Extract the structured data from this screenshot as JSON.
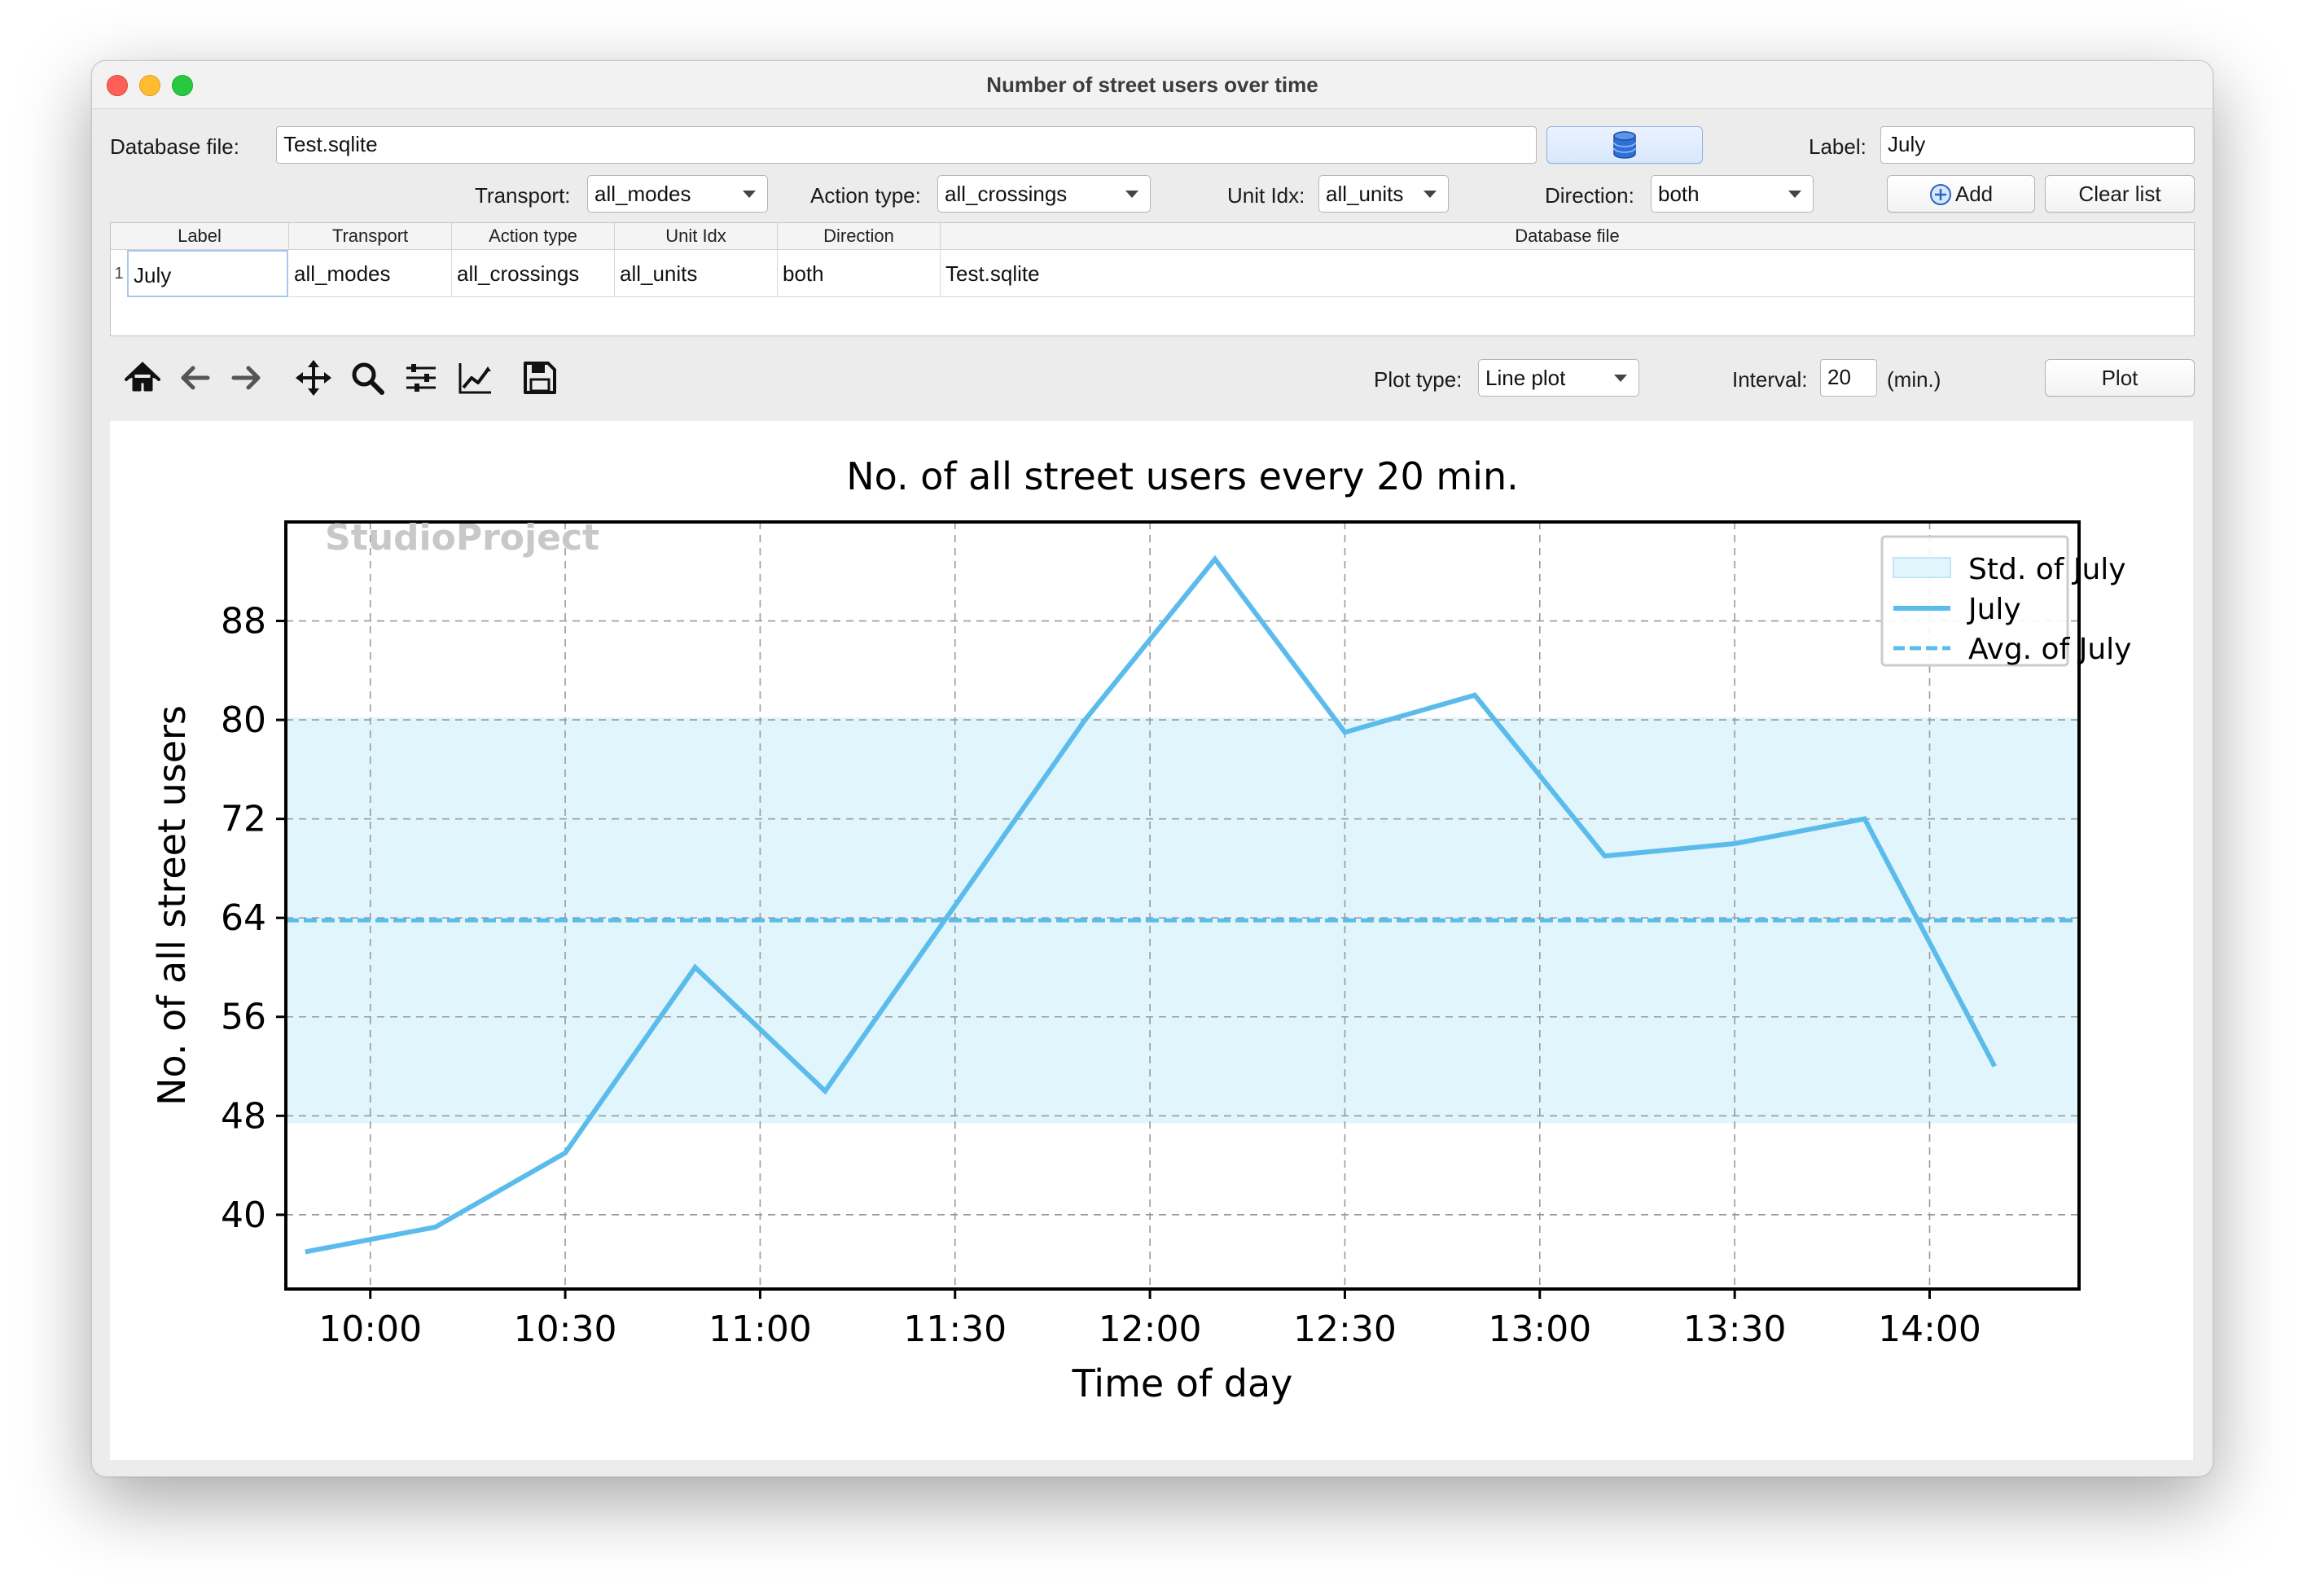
{
  "window": {
    "title": "Number of street users over time"
  },
  "controls": {
    "database_label": "Database file:",
    "database_value": "Test.sqlite",
    "db_button_icon": "database-icon",
    "label_label": "Label:",
    "label_value": "July",
    "transport_label": "Transport:",
    "transport_value": "all_modes",
    "action_label": "Action type:",
    "action_value": "all_crossings",
    "unit_label": "Unit Idx:",
    "unit_value": "all_units",
    "direction_label": "Direction:",
    "direction_value": "both",
    "add_label": "Add",
    "clear_label": "Clear list"
  },
  "table": {
    "headers": [
      "Label",
      "Transport",
      "Action type",
      "Unit Idx",
      "Direction",
      "Database file"
    ],
    "rows": [
      {
        "num": "1",
        "cells": [
          "July",
          "all_modes",
          "all_crossings",
          "all_units",
          "both",
          "Test.sqlite"
        ]
      }
    ]
  },
  "toolbar": {
    "icons": [
      "home-icon",
      "back-arrow-icon",
      "forward-arrow-icon",
      "pan-icon",
      "zoom-icon",
      "configure-subplots-icon",
      "edit-axes-icon",
      "save-icon"
    ],
    "plot_type_label": "Plot type:",
    "plot_type_value": "Line plot",
    "interval_label": "Interval:",
    "interval_value": "20",
    "interval_unit": "(min.)",
    "plot_button": "Plot"
  },
  "colors": {
    "line": "#5bbcec",
    "std_band": "#e1f5fc",
    "grid": "#9a9a9a"
  },
  "chart_data": {
    "type": "line",
    "title": "No. of all street users every 20 min.",
    "xlabel": "Time of day",
    "ylabel": "No. of all street users",
    "watermark": "StudioProject",
    "x_ticks": [
      "10:00",
      "10:30",
      "11:00",
      "11:30",
      "12:00",
      "12:30",
      "13:00",
      "13:30",
      "14:00"
    ],
    "y_ticks": [
      40,
      48,
      56,
      64,
      72,
      80,
      88
    ],
    "xlim": [
      "09:47",
      "14:23"
    ],
    "ylim": [
      34,
      96
    ],
    "grid": true,
    "legend_position": "top-right",
    "series": [
      {
        "name": "July",
        "x": [
          "09:50",
          "10:10",
          "10:30",
          "10:50",
          "11:10",
          "11:30",
          "11:50",
          "12:10",
          "12:30",
          "12:50",
          "13:10",
          "13:30",
          "13:50",
          "14:10"
        ],
        "values": [
          37,
          39,
          45,
          60,
          50,
          65,
          80,
          93,
          79,
          82,
          69,
          70,
          72,
          52
        ]
      }
    ],
    "average": {
      "name": "Avg. of July",
      "value": 63.8
    },
    "std_band": {
      "name": "Std. of July",
      "lower": 47.4,
      "upper": 80.2
    }
  }
}
